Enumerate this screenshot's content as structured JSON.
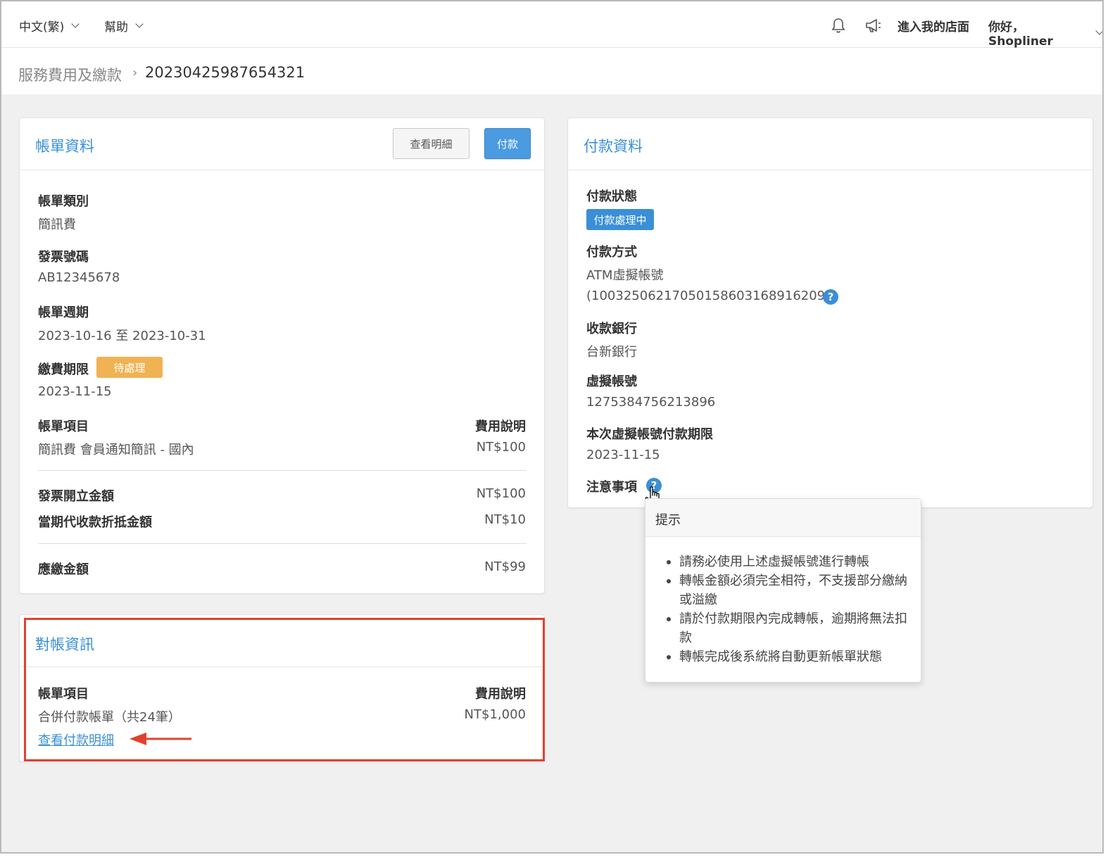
{
  "topbar": {
    "language": "中文(繁)",
    "help": "幫助",
    "store_link": "進入我的店面",
    "greeting": "你好，Shopliner"
  },
  "breadcrumb": {
    "parent": "服務費用及繳款",
    "current": "20230425987654321"
  },
  "bill": {
    "title": "帳單資料",
    "view_details_button": "查看明細",
    "pay_button": "付款",
    "type_label": "帳單類別",
    "type_value": "簡訊費",
    "invoice_label": "發票號碼",
    "invoice_value": "AB12345678",
    "period_label": "帳單週期",
    "period_value": "2023-10-16 至 2023-10-31",
    "due_label": "繳費期限",
    "due_badge": "待處理",
    "due_value": "2023-11-15",
    "items_header": "帳單項目",
    "fee_header": "費用說明",
    "item_name": "簡訊費 會員通知簡訊 - 國內",
    "item_amount": "NT$100",
    "invoice_amount_label": "發票開立金額",
    "invoice_amount_value": "NT$100",
    "offset_label": "當期代收款折抵金額",
    "offset_value": "NT$10",
    "payable_label": "應繳金額",
    "payable_value": "NT$99"
  },
  "reconcile": {
    "title": "對帳資訊",
    "items_header": "帳單項目",
    "fee_header": "費用說明",
    "item_name": "合併付款帳單（共24筆）",
    "item_amount": "NT$1,000",
    "view_link": "查看付款明細"
  },
  "payment": {
    "title": "付款資料",
    "status_label": "付款狀態",
    "status_badge": "付款處理中",
    "method_label": "付款方式",
    "method_value": "ATM虛擬帳號",
    "method_account": "(10032506217050158603168916209)",
    "bank_label": "收款銀行",
    "bank_value": "台新銀行",
    "virtual_label": "虛擬帳號",
    "virtual_value": "1275384756213896",
    "deadline_label": "本次虛擬帳號付款期限",
    "deadline_value": "2023-11-15",
    "notes_label": "注意事項"
  },
  "tooltip": {
    "title": "提示",
    "items": [
      "請務必使用上述虛擬帳號進行轉帳",
      "轉帳金額必須完全相符，不支援部分繳納或溢繳",
      "請於付款期限內完成轉帳，逾期將無法扣款",
      "轉帳完成後系統將自動更新帳單狀態"
    ]
  },
  "colors": {
    "accent": "#3a8fd6",
    "pending": "#f0b253",
    "highlight": "#e0412d"
  }
}
